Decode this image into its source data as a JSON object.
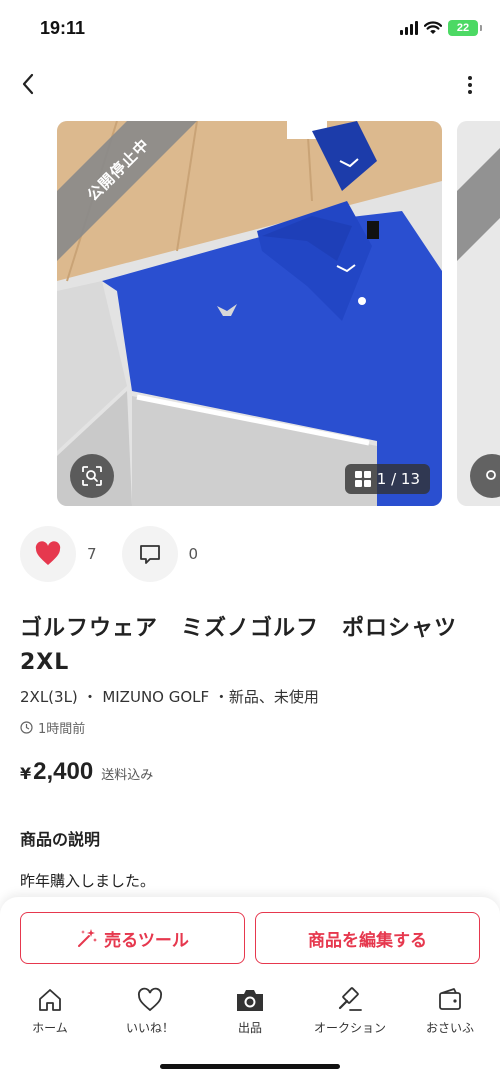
{
  "status_bar": {
    "time": "19:11",
    "battery": "22"
  },
  "product": {
    "ribbon": "公開停止中",
    "image_counter": "1 / 13",
    "likes": "7",
    "comments": "0",
    "title": "ゴルフウェア　ミズノゴルフ　ポロシャツ　2XL",
    "attributes": "2XL(3L) ・ MIZUNO GOLF ・新品、未使用",
    "posted": "1時間前",
    "price_currency": "¥",
    "price": "2,400",
    "shipping": "送料込み",
    "description_heading": "商品の説明",
    "description": "昨年購入しました。"
  },
  "cta": {
    "sell_tools": "売るツール",
    "edit": "商品を編集する"
  },
  "tabs": [
    {
      "label": "ホーム",
      "icon": "home-icon"
    },
    {
      "label": "いいね！",
      "icon": "heart-icon"
    },
    {
      "label": "出品",
      "icon": "camera-icon"
    },
    {
      "label": "オークション",
      "icon": "gavel-icon"
    },
    {
      "label": "おさいふ",
      "icon": "wallet-icon"
    }
  ],
  "colors": {
    "accent": "#e6384e",
    "like": "#e6384e",
    "ribbon": "#8a8a8a"
  }
}
